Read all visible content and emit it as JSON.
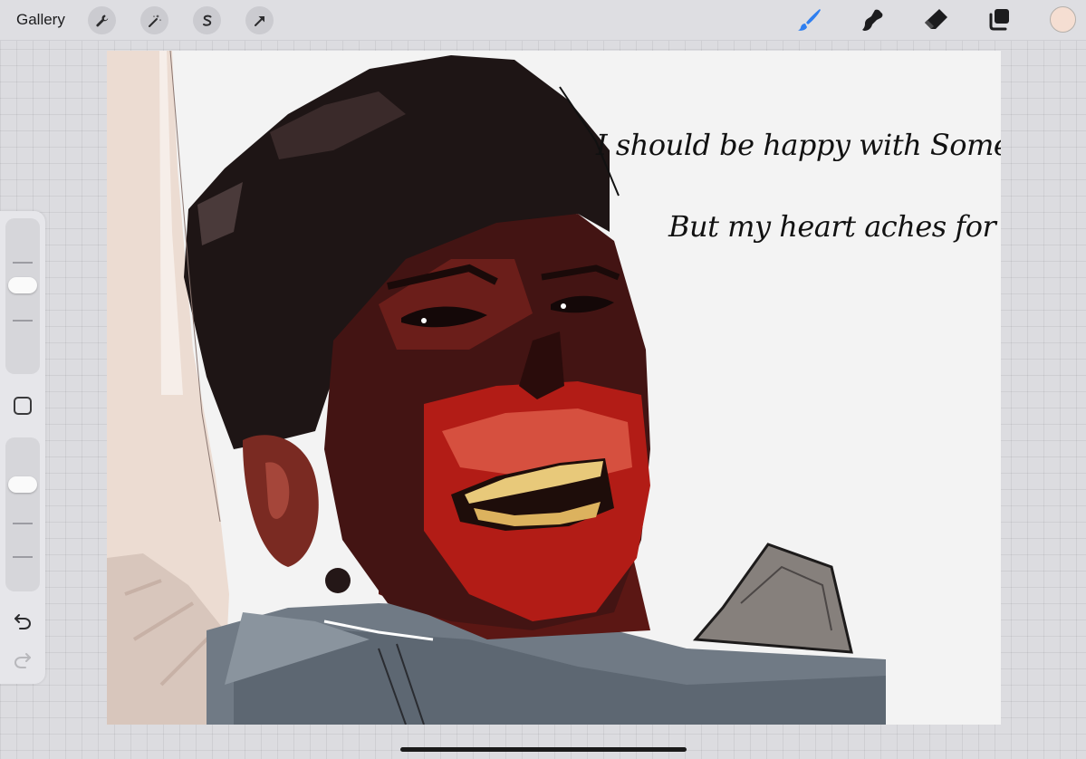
{
  "topbar": {
    "gallery_label": "Gallery",
    "left_tools": [
      "wrench-icon",
      "magic-wand-icon",
      "selection-icon",
      "transform-arrow-icon"
    ],
    "right_tools": [
      "brush-icon",
      "smudge-icon",
      "eraser-icon",
      "layers-icon"
    ],
    "active_tool": "brush-icon",
    "active_color": "#f5ded2",
    "accent_color": "#2f7ff0"
  },
  "sidebar": {
    "brush_size_level": 0.58,
    "opacity_level": 0.72,
    "undo_icon": "undo-icon",
    "redo_icon": "redo-icon",
    "modify_icon": "square-icon"
  },
  "canvas": {
    "handwriting_line_1": "I should be happy with Someone New",
    "handwriting_line_2": "But my heart aches for u"
  }
}
